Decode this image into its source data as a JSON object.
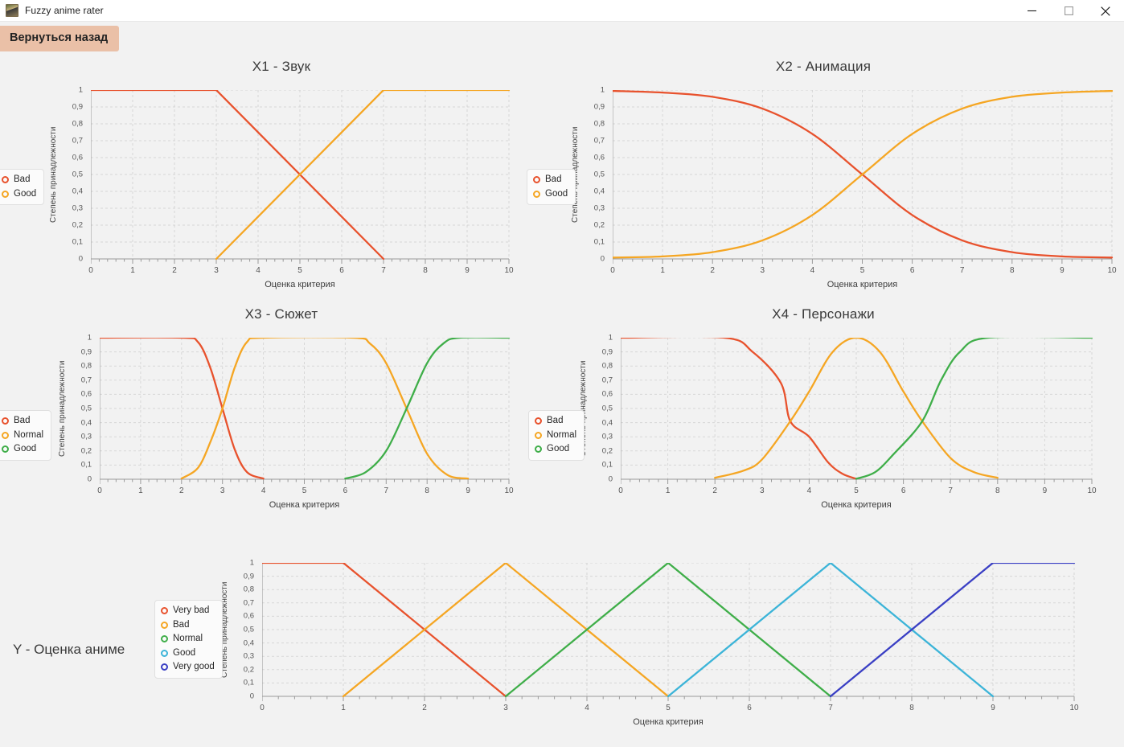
{
  "window": {
    "title": "Fuzzy anime rater",
    "icon": "app-icon",
    "minimize_label": "—",
    "maximize_label": "□",
    "close_label": "✕"
  },
  "toolbar": {
    "back_label": "Вернуться назад",
    "back_bg": "#eac0a7"
  },
  "axis_text": {
    "y": "Степень принадлежности",
    "x": "Оценка критерия"
  },
  "ticks": {
    "y": [
      "0",
      "0,1",
      "0,2",
      "0,3",
      "0,4",
      "0,5",
      "0,6",
      "0,7",
      "0,8",
      "0,9",
      "1"
    ],
    "x": [
      "0",
      "1",
      "2",
      "3",
      "4",
      "5",
      "6",
      "7",
      "8",
      "9",
      "10"
    ]
  },
  "colors": {
    "red": "#e8522d",
    "amber": "#f5a623",
    "green": "#3fae49",
    "lightblue": "#3cb4d8",
    "darkblue": "#3a3fc4",
    "grid": "#cfcfcf",
    "axis": "#9a9a9a",
    "background": "#f2f2f2"
  },
  "charts": [
    {
      "id": "x1",
      "title": "X1 - Звук",
      "legend": [
        {
          "label": "Bad",
          "color": "#e8522d"
        },
        {
          "label": "Good",
          "color": "#f5a623"
        }
      ]
    },
    {
      "id": "x2",
      "title": "X2 - Анимация",
      "legend": [
        {
          "label": "Bad",
          "color": "#e8522d"
        },
        {
          "label": "Good",
          "color": "#f5a623"
        }
      ]
    },
    {
      "id": "x3",
      "title": "X3 - Сюжет",
      "legend": [
        {
          "label": "Bad",
          "color": "#e8522d"
        },
        {
          "label": "Normal",
          "color": "#f5a623"
        },
        {
          "label": "Good",
          "color": "#3fae49"
        }
      ]
    },
    {
      "id": "x4",
      "title": "X4 - Персонажи",
      "legend": [
        {
          "label": "Bad",
          "color": "#e8522d"
        },
        {
          "label": "Normal",
          "color": "#f5a623"
        },
        {
          "label": "Good",
          "color": "#3fae49"
        }
      ]
    },
    {
      "id": "y",
      "title": "Y - Оценка аниме",
      "legend": [
        {
          "label": "Very bad",
          "color": "#e8522d"
        },
        {
          "label": "Bad",
          "color": "#f5a623"
        },
        {
          "label": "Normal",
          "color": "#3fae49"
        },
        {
          "label": "Good",
          "color": "#3cb4d8"
        },
        {
          "label": "Very good",
          "color": "#3a3fc4"
        }
      ]
    }
  ],
  "chart_data": [
    {
      "type": "line",
      "id": "x1",
      "title": "X1 - Звук",
      "xlabel": "Оценка критерия",
      "ylabel": "Степень принадлежности",
      "xlim": [
        0,
        10
      ],
      "ylim": [
        0,
        1
      ],
      "grid": true,
      "legend_position": "left-outside",
      "series": [
        {
          "name": "Bad",
          "color": "#e8522d",
          "shape": "trapezoid-descending",
          "points": [
            [
              0,
              1
            ],
            [
              3,
              1
            ],
            [
              7,
              0
            ]
          ]
        },
        {
          "name": "Good",
          "color": "#f5a623",
          "shape": "trapezoid-ascending",
          "points": [
            [
              3,
              0
            ],
            [
              7,
              1
            ],
            [
              10,
              1
            ]
          ]
        }
      ]
    },
    {
      "type": "line",
      "id": "x2",
      "title": "X2 - Анимация",
      "xlabel": "Оценка критерия",
      "ylabel": "Степень принадлежности",
      "xlim": [
        0,
        10
      ],
      "ylim": [
        0,
        1
      ],
      "grid": true,
      "legend_position": "left-outside",
      "series": [
        {
          "name": "Bad",
          "color": "#e8522d",
          "shape": "sigmoid-descending",
          "midpoint": 5,
          "slope": 1.05,
          "points": [
            [
              0,
              0.995
            ],
            [
              1,
              0.985
            ],
            [
              2,
              0.96
            ],
            [
              3,
              0.89
            ],
            [
              4,
              0.74
            ],
            [
              5,
              0.5
            ],
            [
              6,
              0.26
            ],
            [
              7,
              0.11
            ],
            [
              8,
              0.04
            ],
            [
              9,
              0.015
            ],
            [
              10,
              0.008
            ]
          ]
        },
        {
          "name": "Good",
          "color": "#f5a623",
          "shape": "sigmoid-ascending",
          "midpoint": 5,
          "slope": 1.05,
          "points": [
            [
              0,
              0.008
            ],
            [
              1,
              0.015
            ],
            [
              2,
              0.04
            ],
            [
              3,
              0.11
            ],
            [
              4,
              0.26
            ],
            [
              5,
              0.5
            ],
            [
              6,
              0.74
            ],
            [
              7,
              0.89
            ],
            [
              8,
              0.96
            ],
            [
              9,
              0.985
            ],
            [
              10,
              0.995
            ]
          ]
        }
      ]
    },
    {
      "type": "line",
      "id": "x3",
      "title": "X3 - Сюжет",
      "xlabel": "Оценка критерия",
      "ylabel": "Степень принадлежности",
      "xlim": [
        0,
        10
      ],
      "ylim": [
        0,
        1
      ],
      "grid": true,
      "legend_position": "left-outside",
      "series": [
        {
          "name": "Bad",
          "color": "#e8522d",
          "shape": "smooth-descending",
          "plateau_end": 2.2,
          "midpoint": 3.0,
          "zero_at": 4.0,
          "points": [
            [
              0,
              1
            ],
            [
              2,
              1
            ],
            [
              2.4,
              0.97
            ],
            [
              2.7,
              0.79
            ],
            [
              3,
              0.5
            ],
            [
              3.3,
              0.21
            ],
            [
              3.6,
              0.05
            ],
            [
              4,
              0.005
            ]
          ]
        },
        {
          "name": "Normal",
          "color": "#f5a623",
          "shape": "smooth-trapezoid",
          "rise_start": 2.0,
          "rise_mid": 3.0,
          "plateau": [
            3.6,
            6.2
          ],
          "fall_mid": 7.5,
          "fall_end": 9.0,
          "points": [
            [
              2,
              0.005
            ],
            [
              2.4,
              0.08
            ],
            [
              2.7,
              0.26
            ],
            [
              3,
              0.5
            ],
            [
              3.3,
              0.79
            ],
            [
              3.6,
              0.97
            ],
            [
              4,
              1
            ],
            [
              6.2,
              1
            ],
            [
              6.6,
              0.96
            ],
            [
              7,
              0.82
            ],
            [
              7.5,
              0.5
            ],
            [
              8,
              0.18
            ],
            [
              8.5,
              0.03
            ],
            [
              9,
              0.005
            ]
          ]
        },
        {
          "name": "Good",
          "color": "#3fae49",
          "shape": "smooth-ascending",
          "rise_start": 6.0,
          "midpoint": 7.5,
          "plateau_start": 8.7,
          "points": [
            [
              6,
              0.005
            ],
            [
              6.5,
              0.05
            ],
            [
              7,
              0.2
            ],
            [
              7.5,
              0.5
            ],
            [
              8,
              0.82
            ],
            [
              8.4,
              0.96
            ],
            [
              8.8,
              1
            ],
            [
              10,
              1
            ]
          ]
        }
      ]
    },
    {
      "type": "line",
      "id": "x4",
      "title": "X4 - Персонажи",
      "xlabel": "Оценка критерия",
      "ylabel": "Степень принадлежности",
      "xlim": [
        0,
        10
      ],
      "ylim": [
        0,
        1
      ],
      "grid": true,
      "legend_position": "left-outside",
      "series": [
        {
          "name": "Bad",
          "color": "#e8522d",
          "shape": "cosine-descending",
          "plateau_end": 2.2,
          "zero_at": 5.0,
          "points": [
            [
              0,
              1
            ],
            [
              2.2,
              1
            ],
            [
              2.8,
              0.9
            ],
            [
              3.4,
              0.68
            ],
            [
              3.6,
              0.41
            ],
            [
              4,
              0.3
            ],
            [
              4.4,
              0.12
            ],
            [
              4.7,
              0.04
            ],
            [
              5,
              0.003
            ]
          ]
        },
        {
          "name": "Normal",
          "color": "#f5a623",
          "shape": "bell",
          "peak": 5.0,
          "left_base": 2.0,
          "right_base": 8.0,
          "points": [
            [
              2,
              0.01
            ],
            [
              2.6,
              0.06
            ],
            [
              3,
              0.14
            ],
            [
              3.6,
              0.41
            ],
            [
              4,
              0.62
            ],
            [
              4.5,
              0.9
            ],
            [
              5,
              1
            ],
            [
              5.5,
              0.9
            ],
            [
              6,
              0.62
            ],
            [
              6.4,
              0.41
            ],
            [
              7,
              0.15
            ],
            [
              7.5,
              0.05
            ],
            [
              8,
              0.01
            ]
          ]
        },
        {
          "name": "Good",
          "color": "#3fae49",
          "shape": "cosine-ascending",
          "zero_at": 5.0,
          "plateau_start": 7.8,
          "points": [
            [
              5,
              0.003
            ],
            [
              5.4,
              0.05
            ],
            [
              5.8,
              0.18
            ],
            [
              6.4,
              0.41
            ],
            [
              6.8,
              0.7
            ],
            [
              7.2,
              0.9
            ],
            [
              7.8,
              1
            ],
            [
              10,
              1
            ]
          ]
        }
      ]
    },
    {
      "type": "line",
      "id": "y",
      "title": "Y - Оценка аниме",
      "xlabel": "Оценка критерия",
      "ylabel": "Степень принадлежности",
      "xlim": [
        0,
        10
      ],
      "ylim": [
        0,
        1
      ],
      "grid": true,
      "legend_position": "left-outside",
      "series": [
        {
          "name": "Very bad",
          "color": "#e8522d",
          "shape": "trapezoid-descending",
          "points": [
            [
              0,
              1
            ],
            [
              1,
              1
            ],
            [
              3,
              0
            ]
          ]
        },
        {
          "name": "Bad",
          "color": "#f5a623",
          "shape": "triangle",
          "points": [
            [
              1,
              0
            ],
            [
              3,
              1
            ],
            [
              5,
              0
            ]
          ]
        },
        {
          "name": "Normal",
          "color": "#3fae49",
          "shape": "triangle",
          "points": [
            [
              3,
              0
            ],
            [
              5,
              1
            ],
            [
              7,
              0
            ]
          ]
        },
        {
          "name": "Good",
          "color": "#3cb4d8",
          "shape": "triangle",
          "points": [
            [
              5,
              0
            ],
            [
              7,
              1
            ],
            [
              9,
              0
            ]
          ]
        },
        {
          "name": "Very good",
          "color": "#3a3fc4",
          "shape": "trapezoid-ascending",
          "points": [
            [
              7,
              0
            ],
            [
              9,
              1
            ],
            [
              10,
              1
            ]
          ]
        }
      ]
    }
  ]
}
